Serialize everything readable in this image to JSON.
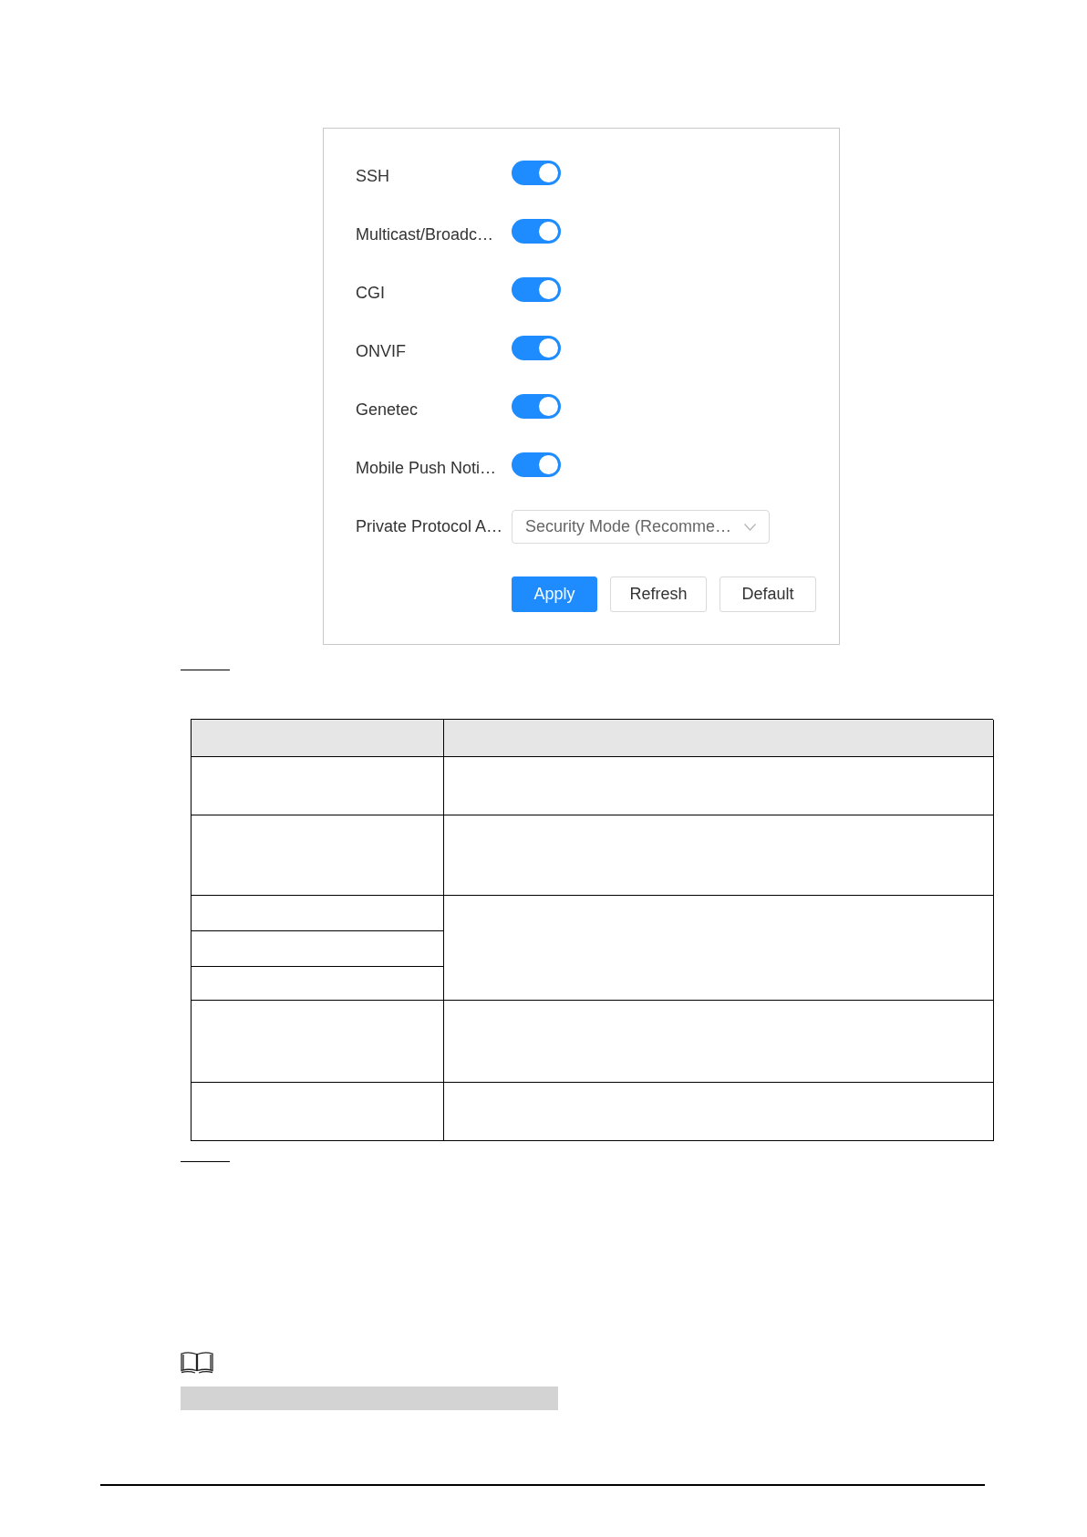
{
  "settings_panel": {
    "toggles": [
      {
        "label": "SSH",
        "on": true
      },
      {
        "label": "Multicast/Broadc…",
        "on": true
      },
      {
        "label": "CGI",
        "on": true
      },
      {
        "label": "ONVIF",
        "on": true
      },
      {
        "label": "Genetec",
        "on": true
      },
      {
        "label": "Mobile Push Noti…",
        "on": true
      }
    ],
    "private_protocol": {
      "label": "Private Protocol A…",
      "value": "Security Mode (Recomme…"
    },
    "buttons": [
      {
        "label": "Apply",
        "kind": "primary"
      },
      {
        "label": "Refresh",
        "kind": "secondary"
      },
      {
        "label": "Default",
        "kind": "secondary"
      }
    ]
  }
}
